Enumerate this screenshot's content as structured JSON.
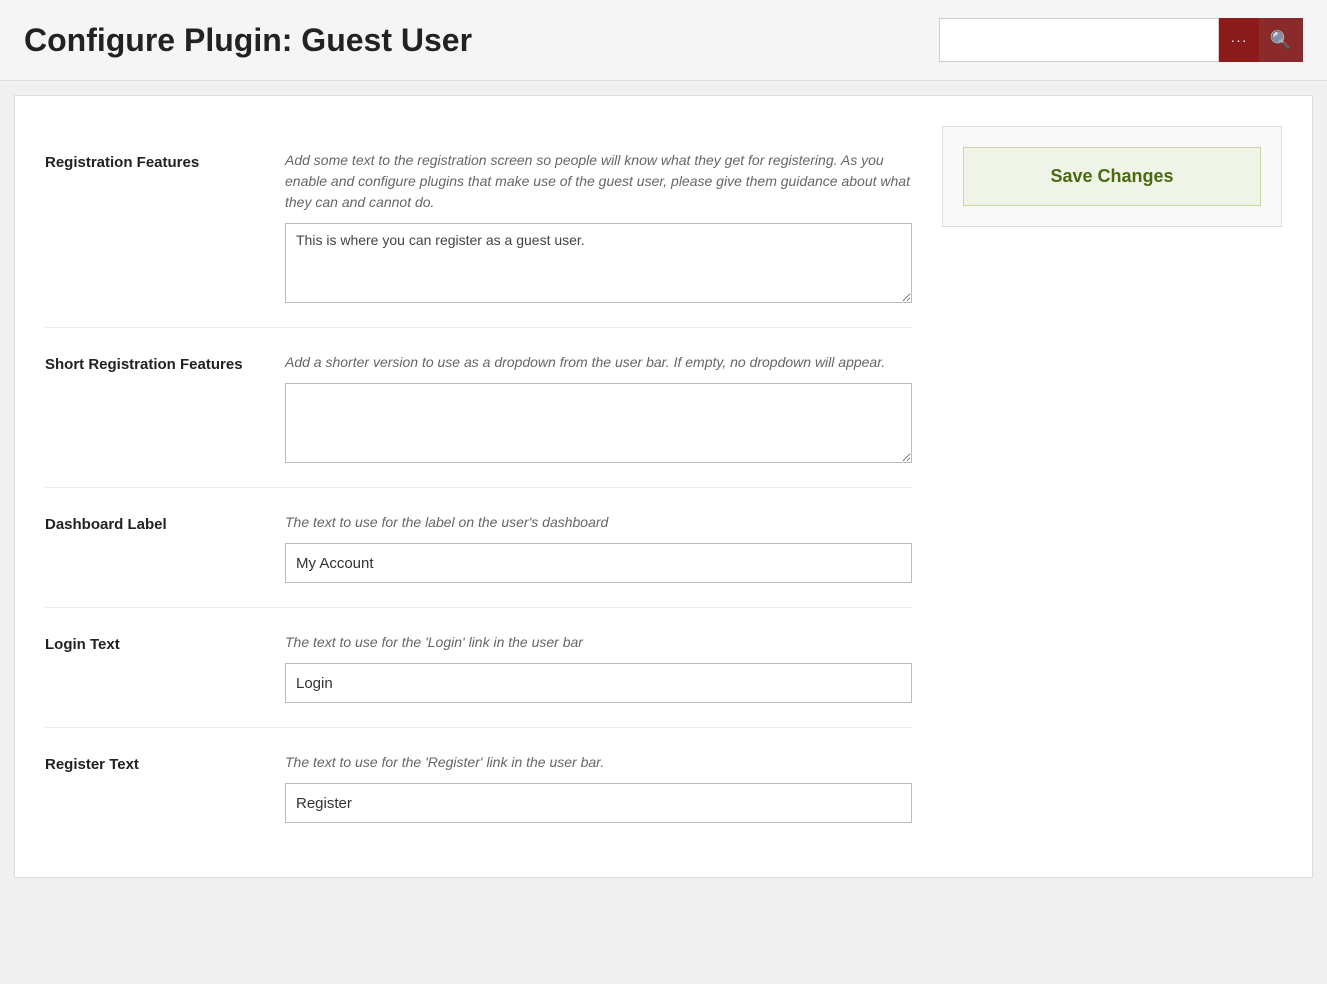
{
  "header": {
    "title": "Configure Plugin: Guest User",
    "search": {
      "placeholder": "",
      "value": "",
      "dots_label": "···",
      "search_label": "🔍"
    }
  },
  "sidebar": {
    "save_changes_label": "Save Changes"
  },
  "fields": [
    {
      "id": "registration_features",
      "label": "Registration Features",
      "description": "Add some text to the registration screen so people will know what they get for registering. As you enable and configure plugins that make use of the guest user, please give them guidance about what they can and cannot do.",
      "type": "textarea",
      "value": "This is where you can register as a guest user."
    },
    {
      "id": "short_registration_features",
      "label": "Short Registration Features",
      "description": "Add a shorter version to use as a dropdown from the user bar. If empty, no dropdown will appear.",
      "type": "textarea",
      "value": ""
    },
    {
      "id": "dashboard_label",
      "label": "Dashboard Label",
      "description": "The text to use for the label on the user's dashboard",
      "type": "input",
      "value": "My Account"
    },
    {
      "id": "login_text",
      "label": "Login Text",
      "description": "The text to use for the 'Login' link in the user bar",
      "type": "input",
      "value": "Login"
    },
    {
      "id": "register_text",
      "label": "Register Text",
      "description": "The text to use for the 'Register' link in the user bar.",
      "type": "input",
      "value": "Register"
    }
  ]
}
